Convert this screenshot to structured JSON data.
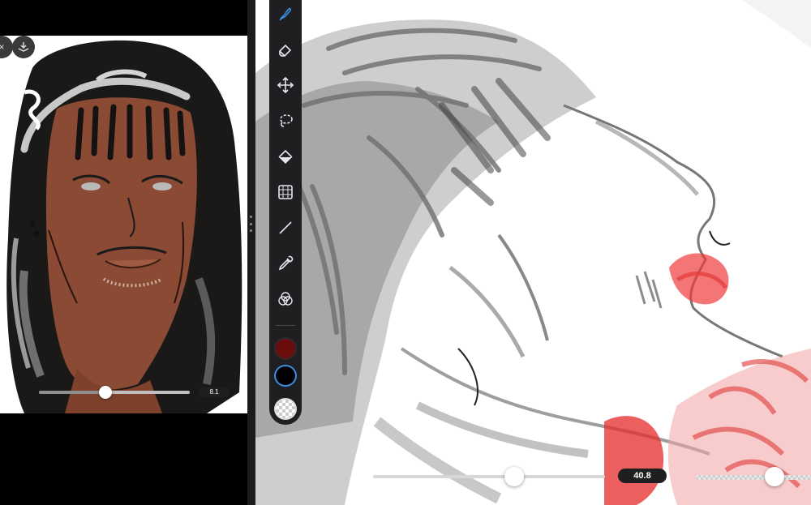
{
  "left_panel": {
    "brush_size_value": "8.1",
    "brush_size_fraction": 0.44,
    "top_buttons": [
      "close-icon",
      "layer-download-icon"
    ]
  },
  "toolbar": {
    "tools": [
      {
        "name": "brush",
        "icon": "brush-icon",
        "active": true
      },
      {
        "name": "eraser",
        "icon": "eraser-icon",
        "active": false
      },
      {
        "name": "move",
        "icon": "move-icon",
        "active": false
      },
      {
        "name": "lasso",
        "icon": "lasso-icon",
        "active": false
      },
      {
        "name": "fill",
        "icon": "fill-icon",
        "active": false
      },
      {
        "name": "transform",
        "icon": "transform-icon",
        "active": false
      },
      {
        "name": "line",
        "icon": "line-icon",
        "active": false
      },
      {
        "name": "eyedropper",
        "icon": "eyedropper-icon",
        "active": false
      },
      {
        "name": "color-blend",
        "icon": "color-blend-icon",
        "active": false
      }
    ],
    "primary_color": "#6b0d0d",
    "secondary_color": "#000000",
    "accent_color": "#3a8ee6"
  },
  "right_panel": {
    "brush_size_value": "40.8",
    "brush_size_fraction": 0.61,
    "opacity_fraction": 0.68
  }
}
